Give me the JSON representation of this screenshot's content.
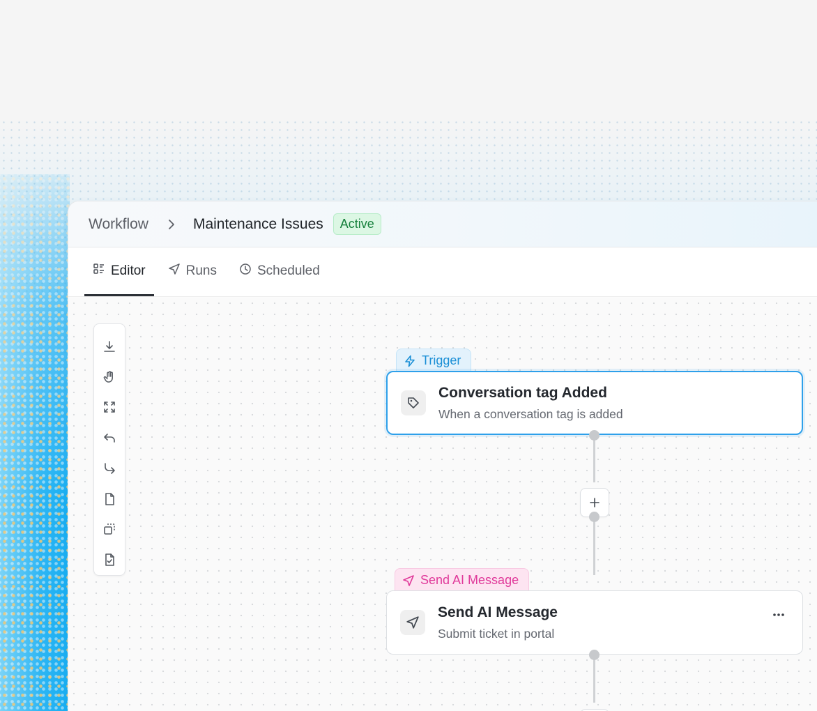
{
  "header": {
    "breadcrumb_root": "Workflow",
    "breadcrumb_current": "Maintenance Issues",
    "status": "Active"
  },
  "tabs": [
    {
      "label": "Editor",
      "icon": "editor-icon",
      "active": true
    },
    {
      "label": "Runs",
      "icon": "send-icon",
      "active": false
    },
    {
      "label": "Scheduled",
      "icon": "clock-icon",
      "active": false
    }
  ],
  "toolbar": {
    "tools": [
      "download-icon",
      "hand-icon",
      "fit-view-icon",
      "undo-icon",
      "redo-icon",
      "file-icon",
      "duplicate-icon",
      "file-check-icon"
    ]
  },
  "nodes": [
    {
      "label": "Trigger",
      "label_icon": "lightning-icon",
      "title": "Conversation tag Added",
      "subtitle": "When a conversation tag is added",
      "icon": "tag-icon"
    },
    {
      "label": "Send AI Message",
      "label_icon": "send-icon",
      "title": "Send AI Message",
      "subtitle": "Submit ticket in portal",
      "icon": "send-icon"
    }
  ],
  "colors": {
    "active_badge_text": "#16803c",
    "active_badge_bg": "#dcf7e4",
    "trigger_accent": "#1a8fd6",
    "ai_accent": "#e0399a",
    "selected_border": "#2ea0ea"
  }
}
